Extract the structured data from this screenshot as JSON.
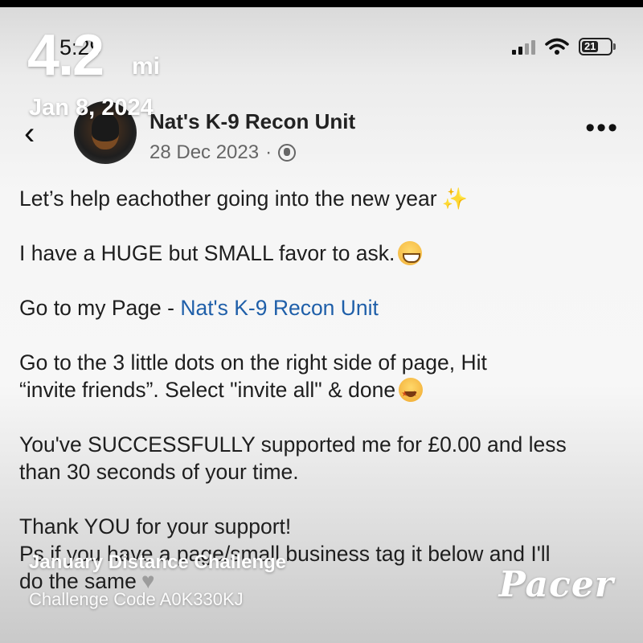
{
  "status": {
    "time": "5:29",
    "battery": "21"
  },
  "overlay": {
    "distance": "4.2",
    "unit": "mi",
    "date": "Jan 8, 2024",
    "challenge": "January Distance Challenge",
    "code": "Challenge Code A0K330KJ",
    "logo": "Pacer"
  },
  "post": {
    "page_name": "Nat's K-9 Recon Unit",
    "date": "28 Dec 2023",
    "separator": "·",
    "lines": {
      "l1": "Let’s help eachother going into the new year",
      "l2": "I have a HUGE but SMALL favor to ask.",
      "l3a": "Go to my  Page - ",
      "l3b": "Nat's K-9 Recon Unit",
      "l4a": "Go to the 3 little dots on the right side of page, Hit",
      "l4b": "“invite friends”. Select \"invite all\" & done",
      "l5a": "You've SUCCESSFULLY supported me for £0.00 and less",
      "l5b": "than 30 seconds of your time.",
      "l6": "Thank YOU for your support!",
      "l7a": "Ps if you have a page/small business tag it below and I'll",
      "l7b": "do the same"
    }
  },
  "icons": [
    "back-chevron-icon",
    "globe-icon",
    "more-options-icon",
    "signal-icon",
    "wifi-icon",
    "battery-icon",
    "sparkles-emoji",
    "grin-emoji",
    "star-struck-emoji",
    "heart-emoji"
  ]
}
